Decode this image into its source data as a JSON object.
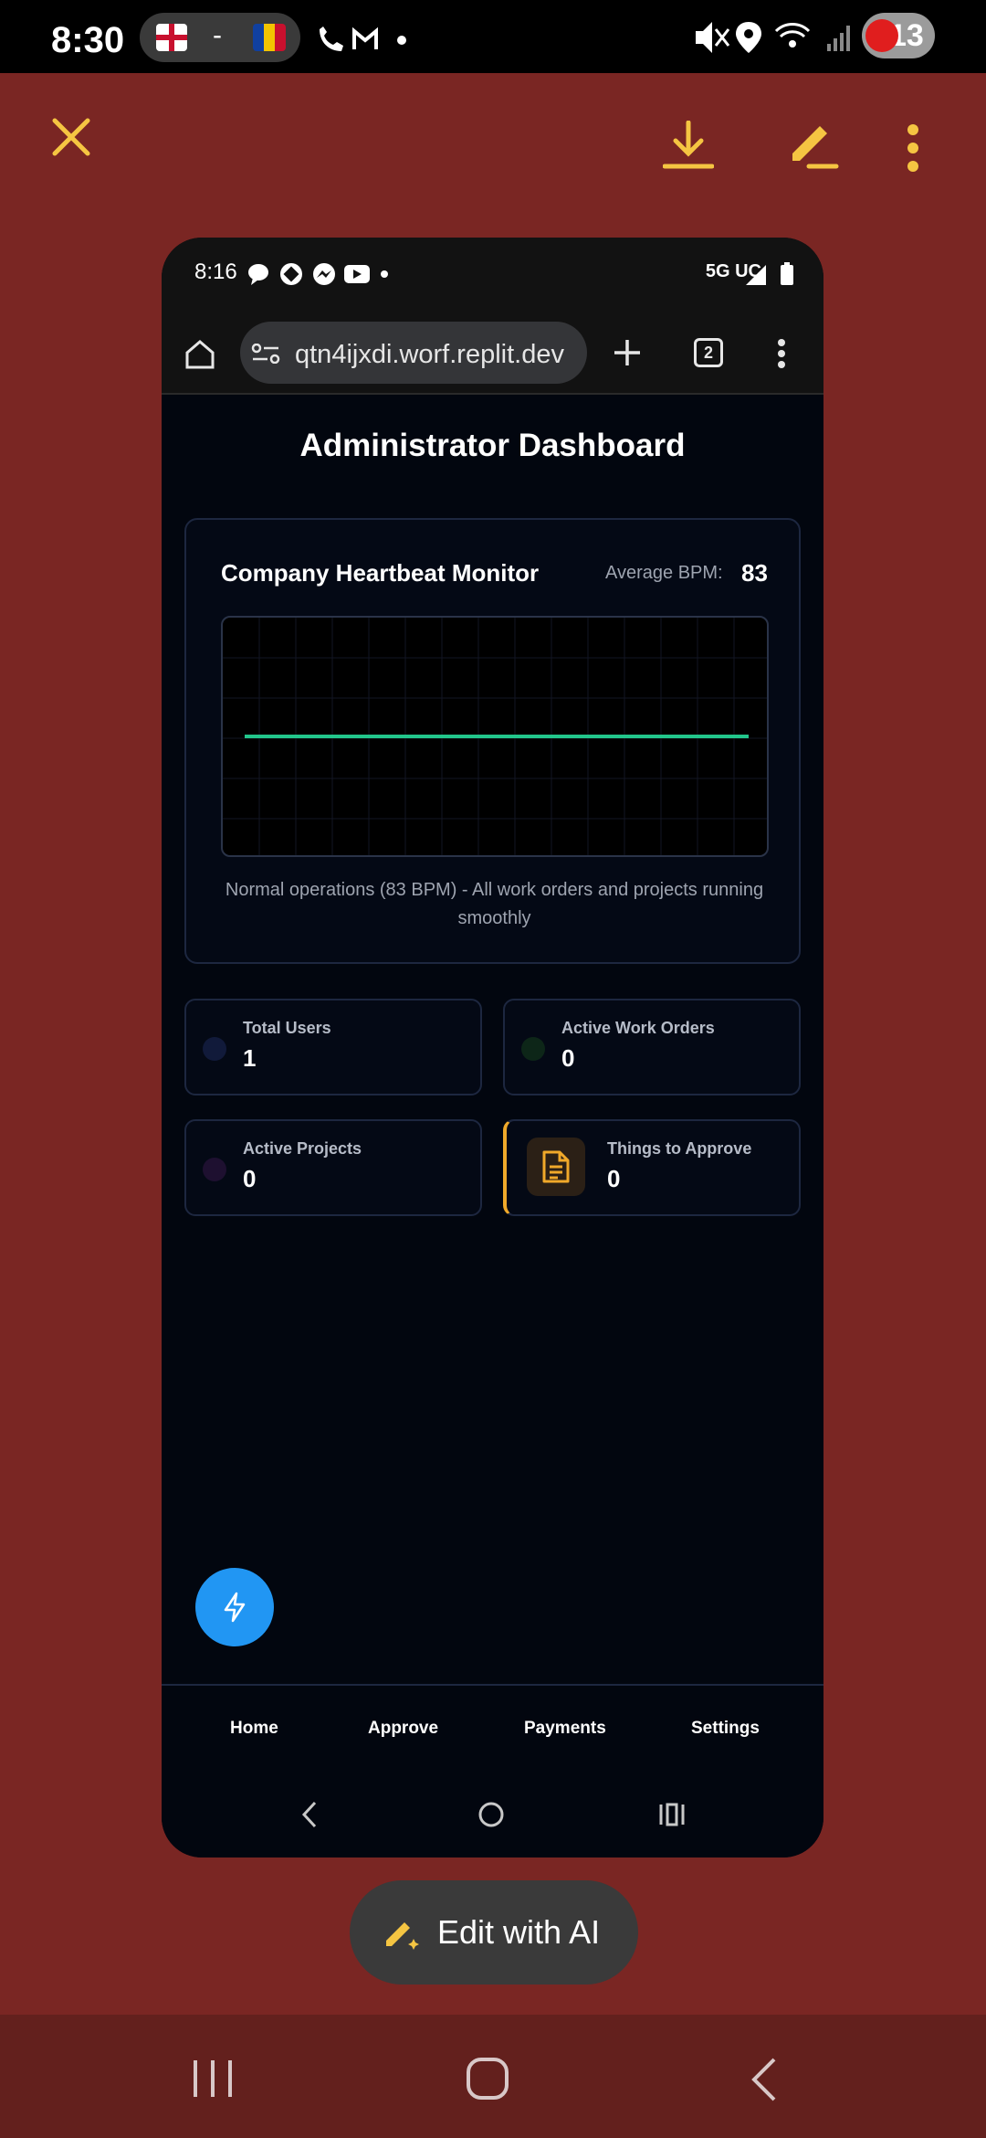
{
  "status_bar": {
    "time": "8:30",
    "separator": "-",
    "battery": "13"
  },
  "viewer_toolbar": {
    "icons": [
      "close-icon",
      "download-icon",
      "edit-icon",
      "more-vert-icon"
    ],
    "accent_color": "#f5c542",
    "background_color": "#7a2623"
  },
  "phone": {
    "status_bar": {
      "time": "8:16",
      "network": "5G UC"
    },
    "browser": {
      "url": "qtn4ijxdi.worf.replit.dev",
      "tab_count": "2"
    },
    "page": {
      "title": "Administrator Dashboard",
      "heartbeat": {
        "title": "Company Heartbeat Monitor",
        "avg_label": "Average BPM:",
        "avg_value": "83",
        "description": "Normal operations (83 BPM) - All work orders and projects running smoothly",
        "line_color": "#22c58b"
      },
      "stats": [
        {
          "label": "Total Users",
          "value": "1"
        },
        {
          "label": "Active Work Orders",
          "value": "0"
        },
        {
          "label": "Active Projects",
          "value": "0"
        },
        {
          "label": "Things to Approve",
          "value": "0"
        }
      ],
      "nav": [
        "Home",
        "Approve",
        "Payments",
        "Settings"
      ]
    }
  },
  "edit_ai": {
    "label": "Edit with AI"
  }
}
